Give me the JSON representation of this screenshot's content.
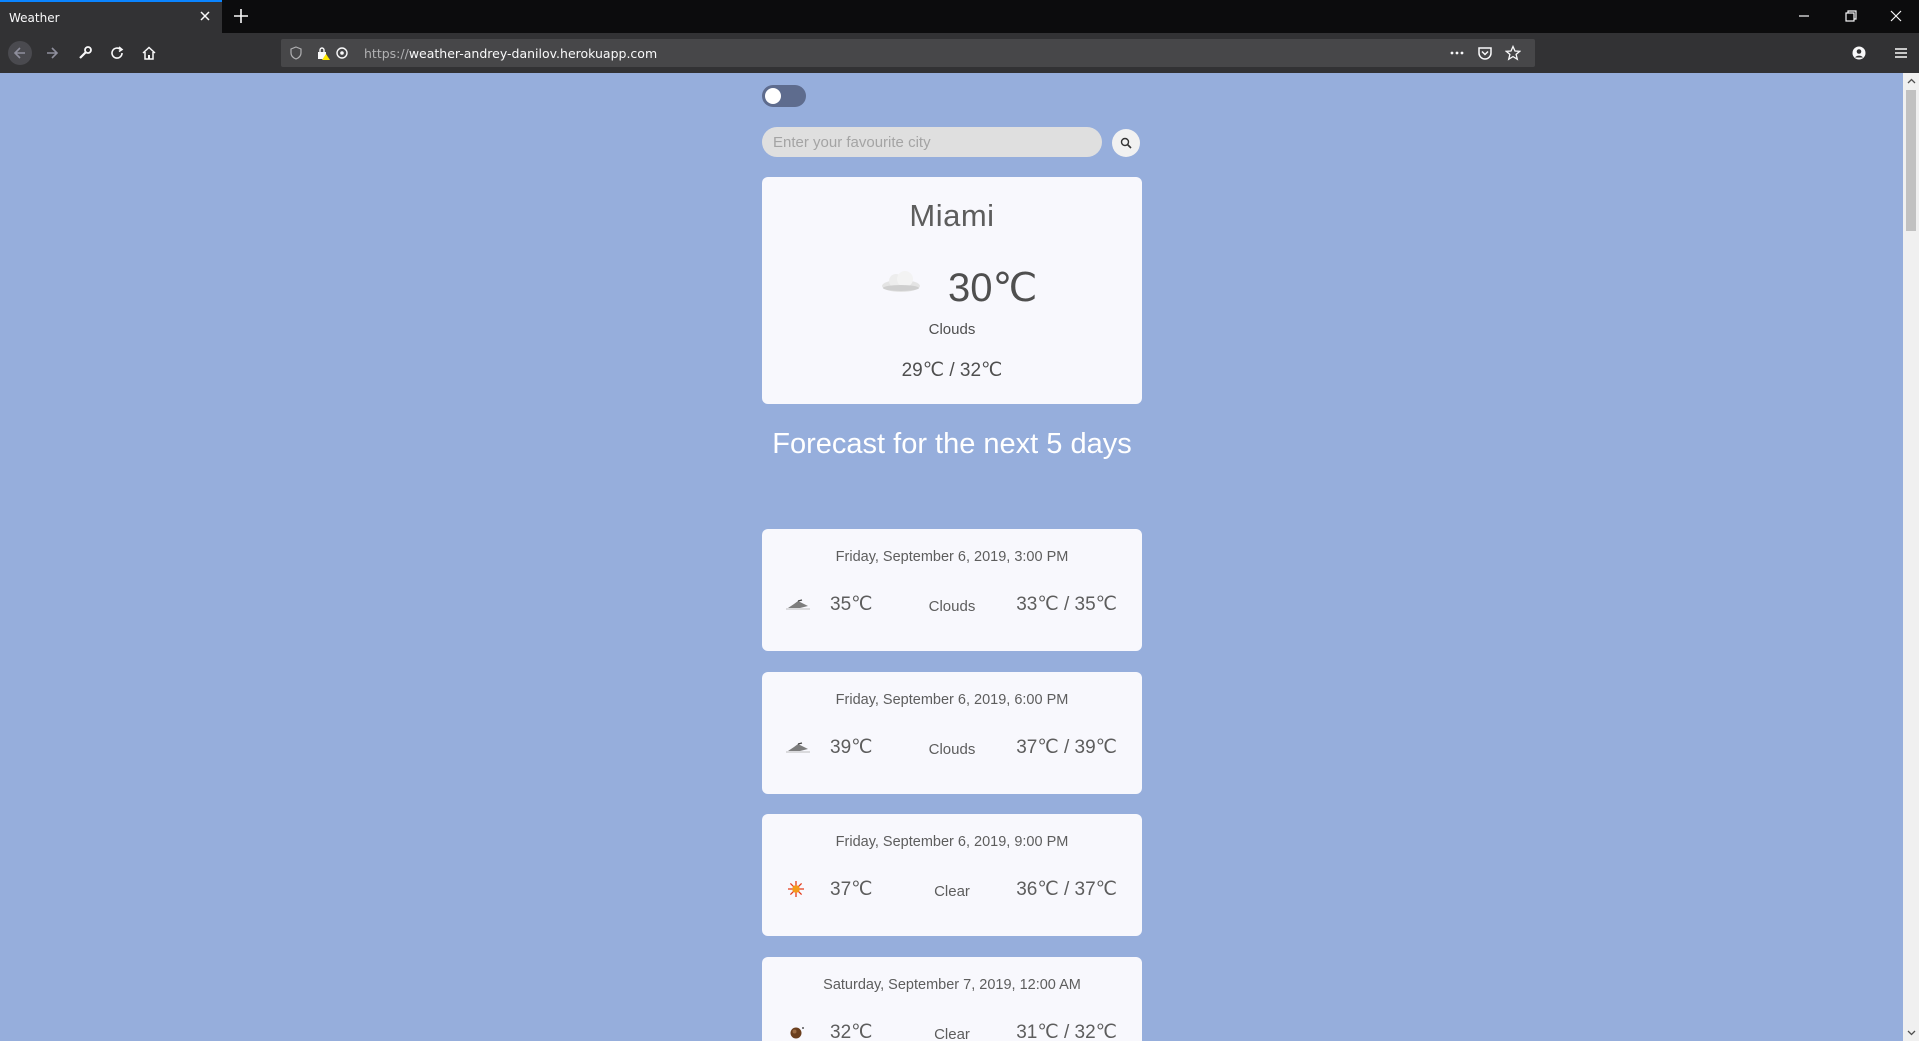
{
  "browser": {
    "tab_title": "Weather",
    "url_scheme": "https://",
    "url_host": "weather-andrey-danilov.herokuapp.com"
  },
  "page": {
    "search_placeholder": "Enter your favourite city",
    "current": {
      "city": "Miami",
      "temp": "30℃",
      "description": "Clouds",
      "icon": "cloud-icon",
      "range": "29℃ / 32℃"
    },
    "forecast_title": "Forecast for the next 5 days",
    "forecast": [
      {
        "date": "Friday, September 6, 2019, 3:00 PM",
        "temp": "35℃",
        "description": "Clouds",
        "range": "33℃ / 35℃",
        "icon": "cloud-icon"
      },
      {
        "date": "Friday, September 6, 2019, 6:00 PM",
        "temp": "39℃",
        "description": "Clouds",
        "range": "37℃ / 39℃",
        "icon": "cloud-icon"
      },
      {
        "date": "Friday, September 6, 2019, 9:00 PM",
        "temp": "37℃",
        "description": "Clear",
        "range": "36℃ / 37℃",
        "icon": "sun-icon"
      },
      {
        "date": "Saturday, September 7, 2019, 12:00 AM",
        "temp": "32℃",
        "description": "Clear",
        "range": "31℃ / 32℃",
        "icon": "moon-icon"
      }
    ]
  },
  "colors": {
    "page_background": "#96aedc",
    "card_background": "#f8f8fd",
    "toggle_track": "#5e6c8e"
  }
}
